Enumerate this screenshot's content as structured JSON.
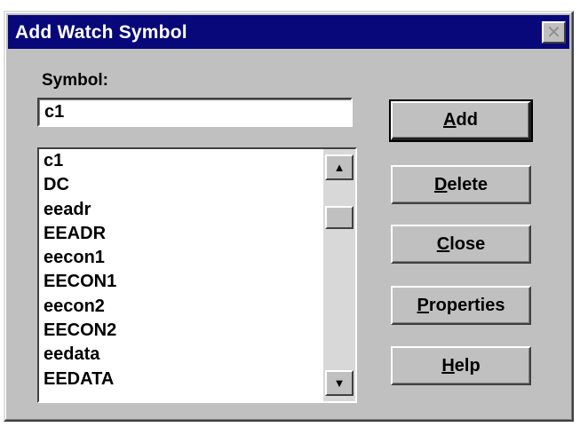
{
  "window": {
    "title": "Add Watch Symbol",
    "close_glyph": "✕"
  },
  "symbol": {
    "label": "Symbol:",
    "value": "c1"
  },
  "symbols_list": {
    "items": [
      "c1",
      "DC",
      "eeadr",
      "EEADR",
      "eecon1",
      "EECON1",
      "eecon2",
      "EECON2",
      "eedata",
      "EEDATA"
    ],
    "scroll_up_icon": "▲",
    "scroll_down_icon": "▼"
  },
  "buttons": {
    "add": {
      "mnemonic": "A",
      "rest": "dd"
    },
    "delete": {
      "mnemonic": "D",
      "rest": "elete"
    },
    "close": {
      "mnemonic": "C",
      "rest": "lose"
    },
    "properties": {
      "mnemonic": "P",
      "rest": "roperties"
    },
    "help": {
      "mnemonic": "H",
      "rest": "elp"
    }
  },
  "colors": {
    "titlebar": "#08087a",
    "dialog_face": "#c0c0c0"
  }
}
